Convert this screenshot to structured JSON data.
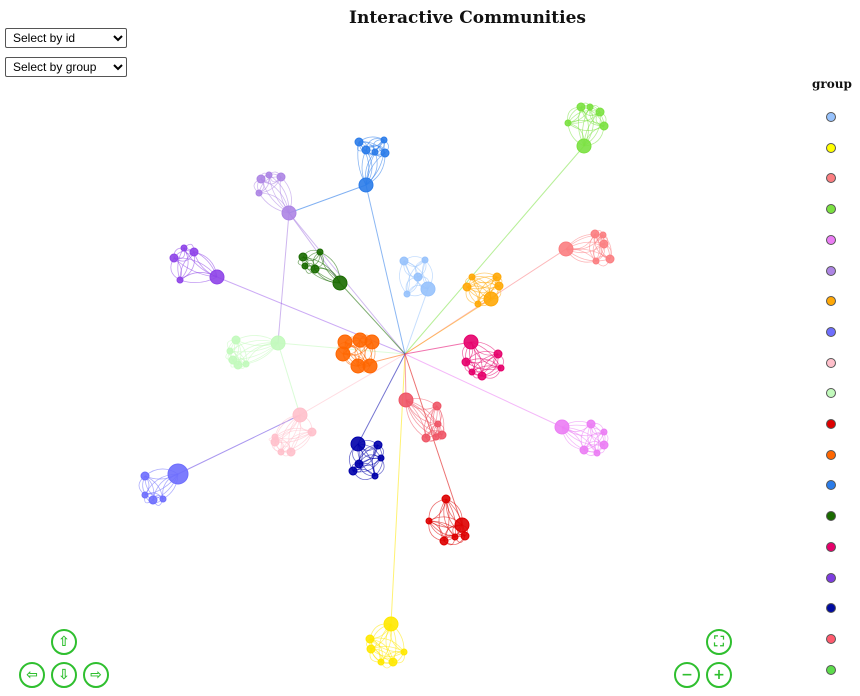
{
  "title": "Interactive Communities",
  "controls": {
    "select_id_label": "Select by id",
    "select_group_label": "Select by group"
  },
  "legend": {
    "title": "group",
    "colors": [
      "#97c2fc",
      "#ffff00",
      "#fb7e81",
      "#7be141",
      "#eb7df4",
      "#ad85e4",
      "#ffa807",
      "#6e6efd",
      "#ffc0cb",
      "#c2fabc",
      "#dd0000",
      "#ff6600",
      "#2b7ce9",
      "#1a6b00",
      "#e6006b",
      "#7e3ce0",
      "#000aa0",
      "#ff5a6e",
      "#5ddc4c"
    ]
  },
  "navigation": {
    "up_icon": "arrow-up-icon",
    "down_icon": "arrow-down-icon",
    "left_icon": "arrow-left-icon",
    "right_icon": "arrow-right-icon",
    "fit_icon": "zoom-extends-icon",
    "zoom_out_icon": "zoom-out-icon",
    "zoom_in_icon": "zoom-in-icon"
  },
  "network": {
    "center": [
      405,
      354
    ],
    "communities": [
      {
        "group": 1,
        "color": "#97c2fc",
        "hub": [
          428,
          289
        ],
        "members": [
          [
            404,
            261
          ],
          [
            425,
            260
          ],
          [
            418,
            277
          ],
          [
            407,
            294
          ]
        ]
      },
      {
        "group": 2,
        "color": "#ffe800",
        "hub": [
          391,
          624
        ],
        "members": [
          [
            371,
            649
          ],
          [
            381,
            662
          ],
          [
            393,
            662
          ],
          [
            404,
            652
          ],
          [
            370,
            639
          ]
        ]
      },
      {
        "group": 3,
        "color": "#fb7e81",
        "hub": [
          566,
          249
        ],
        "members": [
          [
            595,
            234
          ],
          [
            603,
            235
          ],
          [
            604,
            244
          ],
          [
            596,
            261
          ],
          [
            610,
            259
          ]
        ]
      },
      {
        "group": 4,
        "color": "#7be141",
        "hub": [
          584,
          146
        ],
        "members": [
          [
            581,
            107
          ],
          [
            590,
            107
          ],
          [
            600,
            112
          ],
          [
            568,
            123
          ],
          [
            604,
            126
          ]
        ]
      },
      {
        "group": 5,
        "color": "#eb7df4",
        "hub": [
          562,
          427
        ],
        "members": [
          [
            591,
            424
          ],
          [
            604,
            432
          ],
          [
            604,
            445
          ],
          [
            597,
            453
          ],
          [
            584,
            450
          ]
        ]
      },
      {
        "group": 6,
        "color": "#ad85e4",
        "hub": [
          289,
          213
        ],
        "members": [
          [
            261,
            179
          ],
          [
            269,
            175
          ],
          [
            281,
            177
          ],
          [
            259,
            193
          ]
        ]
      },
      {
        "group": 7,
        "color": "#ffa807",
        "hub": [
          491,
          299
        ],
        "members": [
          [
            467,
            287
          ],
          [
            472,
            277
          ],
          [
            497,
            277
          ],
          [
            478,
            304
          ],
          [
            499,
            286
          ]
        ]
      },
      {
        "group": 8,
        "color": "#6e6efd",
        "hub": [
          178,
          474
        ],
        "members": [
          [
            145,
            476
          ],
          [
            145,
            495
          ],
          [
            153,
            500
          ],
          [
            163,
            499
          ]
        ]
      },
      {
        "group": 9,
        "color": "#ffc0cb",
        "hub": [
          300,
          415
        ],
        "members": [
          [
            312,
            432
          ],
          [
            275,
            437
          ],
          [
            291,
            452
          ],
          [
            281,
            452
          ],
          [
            275,
            442
          ]
        ]
      },
      {
        "group": 10,
        "color": "#c2fabc",
        "hub": [
          278,
          343
        ],
        "members": [
          [
            236,
            340
          ],
          [
            230,
            351
          ],
          [
            233,
            360
          ],
          [
            246,
            364
          ],
          [
            238,
            365
          ]
        ]
      },
      {
        "group": 11,
        "color": "#dd0000",
        "hub": [
          462,
          525
        ],
        "members": [
          [
            446,
            499
          ],
          [
            429,
            521
          ],
          [
            444,
            541
          ],
          [
            455,
            537
          ],
          [
            465,
            536
          ]
        ]
      },
      {
        "group": 12,
        "color": "#ff6600",
        "hub": [
          358,
          366
        ],
        "members": [
          [
            345,
            342
          ],
          [
            343,
            354
          ],
          [
            372,
            342
          ],
          [
            370,
            366
          ],
          [
            360,
            340
          ]
        ]
      },
      {
        "group": 13,
        "color": "#2b7ce9",
        "hub": [
          366,
          185
        ],
        "members": [
          [
            359,
            142
          ],
          [
            384,
            140
          ],
          [
            385,
            153
          ],
          [
            375,
            152
          ],
          [
            366,
            150
          ]
        ]
      },
      {
        "group": 14,
        "color": "#1a6b00",
        "hub": [
          340,
          283
        ],
        "members": [
          [
            303,
            257
          ],
          [
            305,
            266
          ],
          [
            315,
            269
          ],
          [
            320,
            252
          ]
        ]
      },
      {
        "group": 15,
        "color": "#e6006b",
        "hub": [
          471,
          342
        ],
        "members": [
          [
            482,
            376
          ],
          [
            472,
            372
          ],
          [
            498,
            354
          ],
          [
            501,
            368
          ],
          [
            466,
            362
          ]
        ]
      },
      {
        "group": 16,
        "color": "#8e44e8",
        "hub": [
          217,
          277
        ],
        "members": [
          [
            174,
            258
          ],
          [
            180,
            280
          ],
          [
            194,
            252
          ],
          [
            184,
            248
          ]
        ]
      },
      {
        "group": 17,
        "color": "#0000aa",
        "hub": [
          358,
          444
        ],
        "members": [
          [
            353,
            471
          ],
          [
            375,
            476
          ],
          [
            378,
            445
          ],
          [
            381,
            458
          ],
          [
            359,
            464
          ]
        ]
      },
      {
        "group": 18,
        "color": "#ee5566",
        "hub": [
          406,
          400
        ],
        "members": [
          [
            437,
            406
          ],
          [
            438,
            424
          ],
          [
            442,
            435
          ],
          [
            436,
            437
          ],
          [
            426,
            438
          ]
        ]
      }
    ],
    "bridges": [
      [
        13,
        6
      ],
      [
        6,
        10
      ],
      [
        10,
        9
      ],
      [
        9,
        8
      ],
      [
        6,
        14
      ]
    ]
  }
}
